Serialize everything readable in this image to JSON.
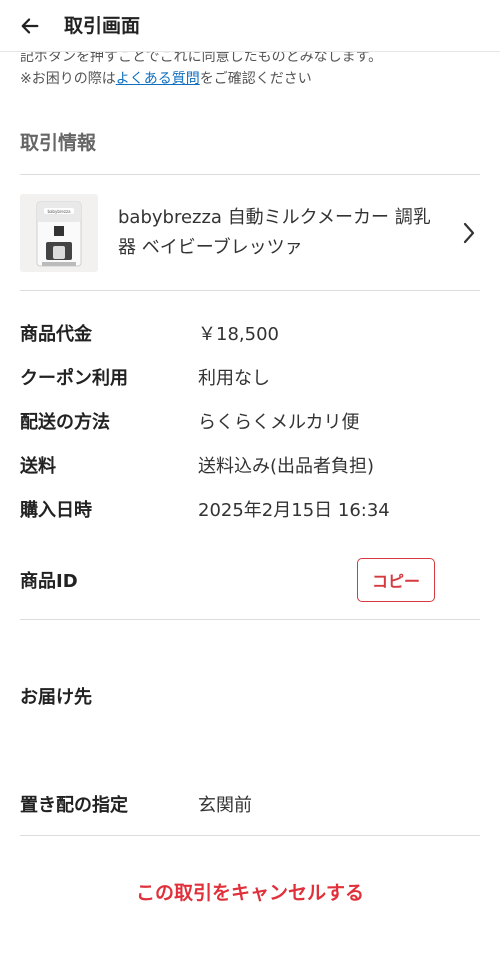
{
  "header": {
    "title": "取引画面",
    "back_icon": "arrow-left-icon"
  },
  "notice": {
    "cut_line": "記ボタンを押すことでこれに同意したものとみなします。",
    "prefix": "※お困りの際は",
    "link": "よくある質問",
    "suffix": "をご確認ください"
  },
  "section": {
    "title": "取引情報"
  },
  "product": {
    "name": "babybrezza 自動ミルクメーカー 調乳器 ベイビーブレッツァ",
    "chevron_icon": "chevron-right-icon",
    "thumb_label": "babybrezza"
  },
  "details": {
    "price": {
      "label": "商品代金",
      "value": "￥18,500"
    },
    "coupon": {
      "label": "クーポン利用",
      "value": "利用なし"
    },
    "shipping_method": {
      "label": "配送の方法",
      "value": "らくらくメルカリ便"
    },
    "shipping_fee": {
      "label": "送料",
      "value": "送料込み(出品者負担)"
    },
    "purchase_date": {
      "label": "購入日時",
      "value": "2025年2月15日 16:34"
    },
    "product_id": {
      "label": "商品ID",
      "copy": "コピー"
    }
  },
  "delivery": {
    "title": "お届け先"
  },
  "drop_off": {
    "label": "置き配の指定",
    "value": "玄関前"
  },
  "cancel": {
    "label": "この取引をキャンセルする"
  },
  "colors": {
    "accent_red": "#e0303a",
    "link_blue": "#0f6fc0"
  }
}
